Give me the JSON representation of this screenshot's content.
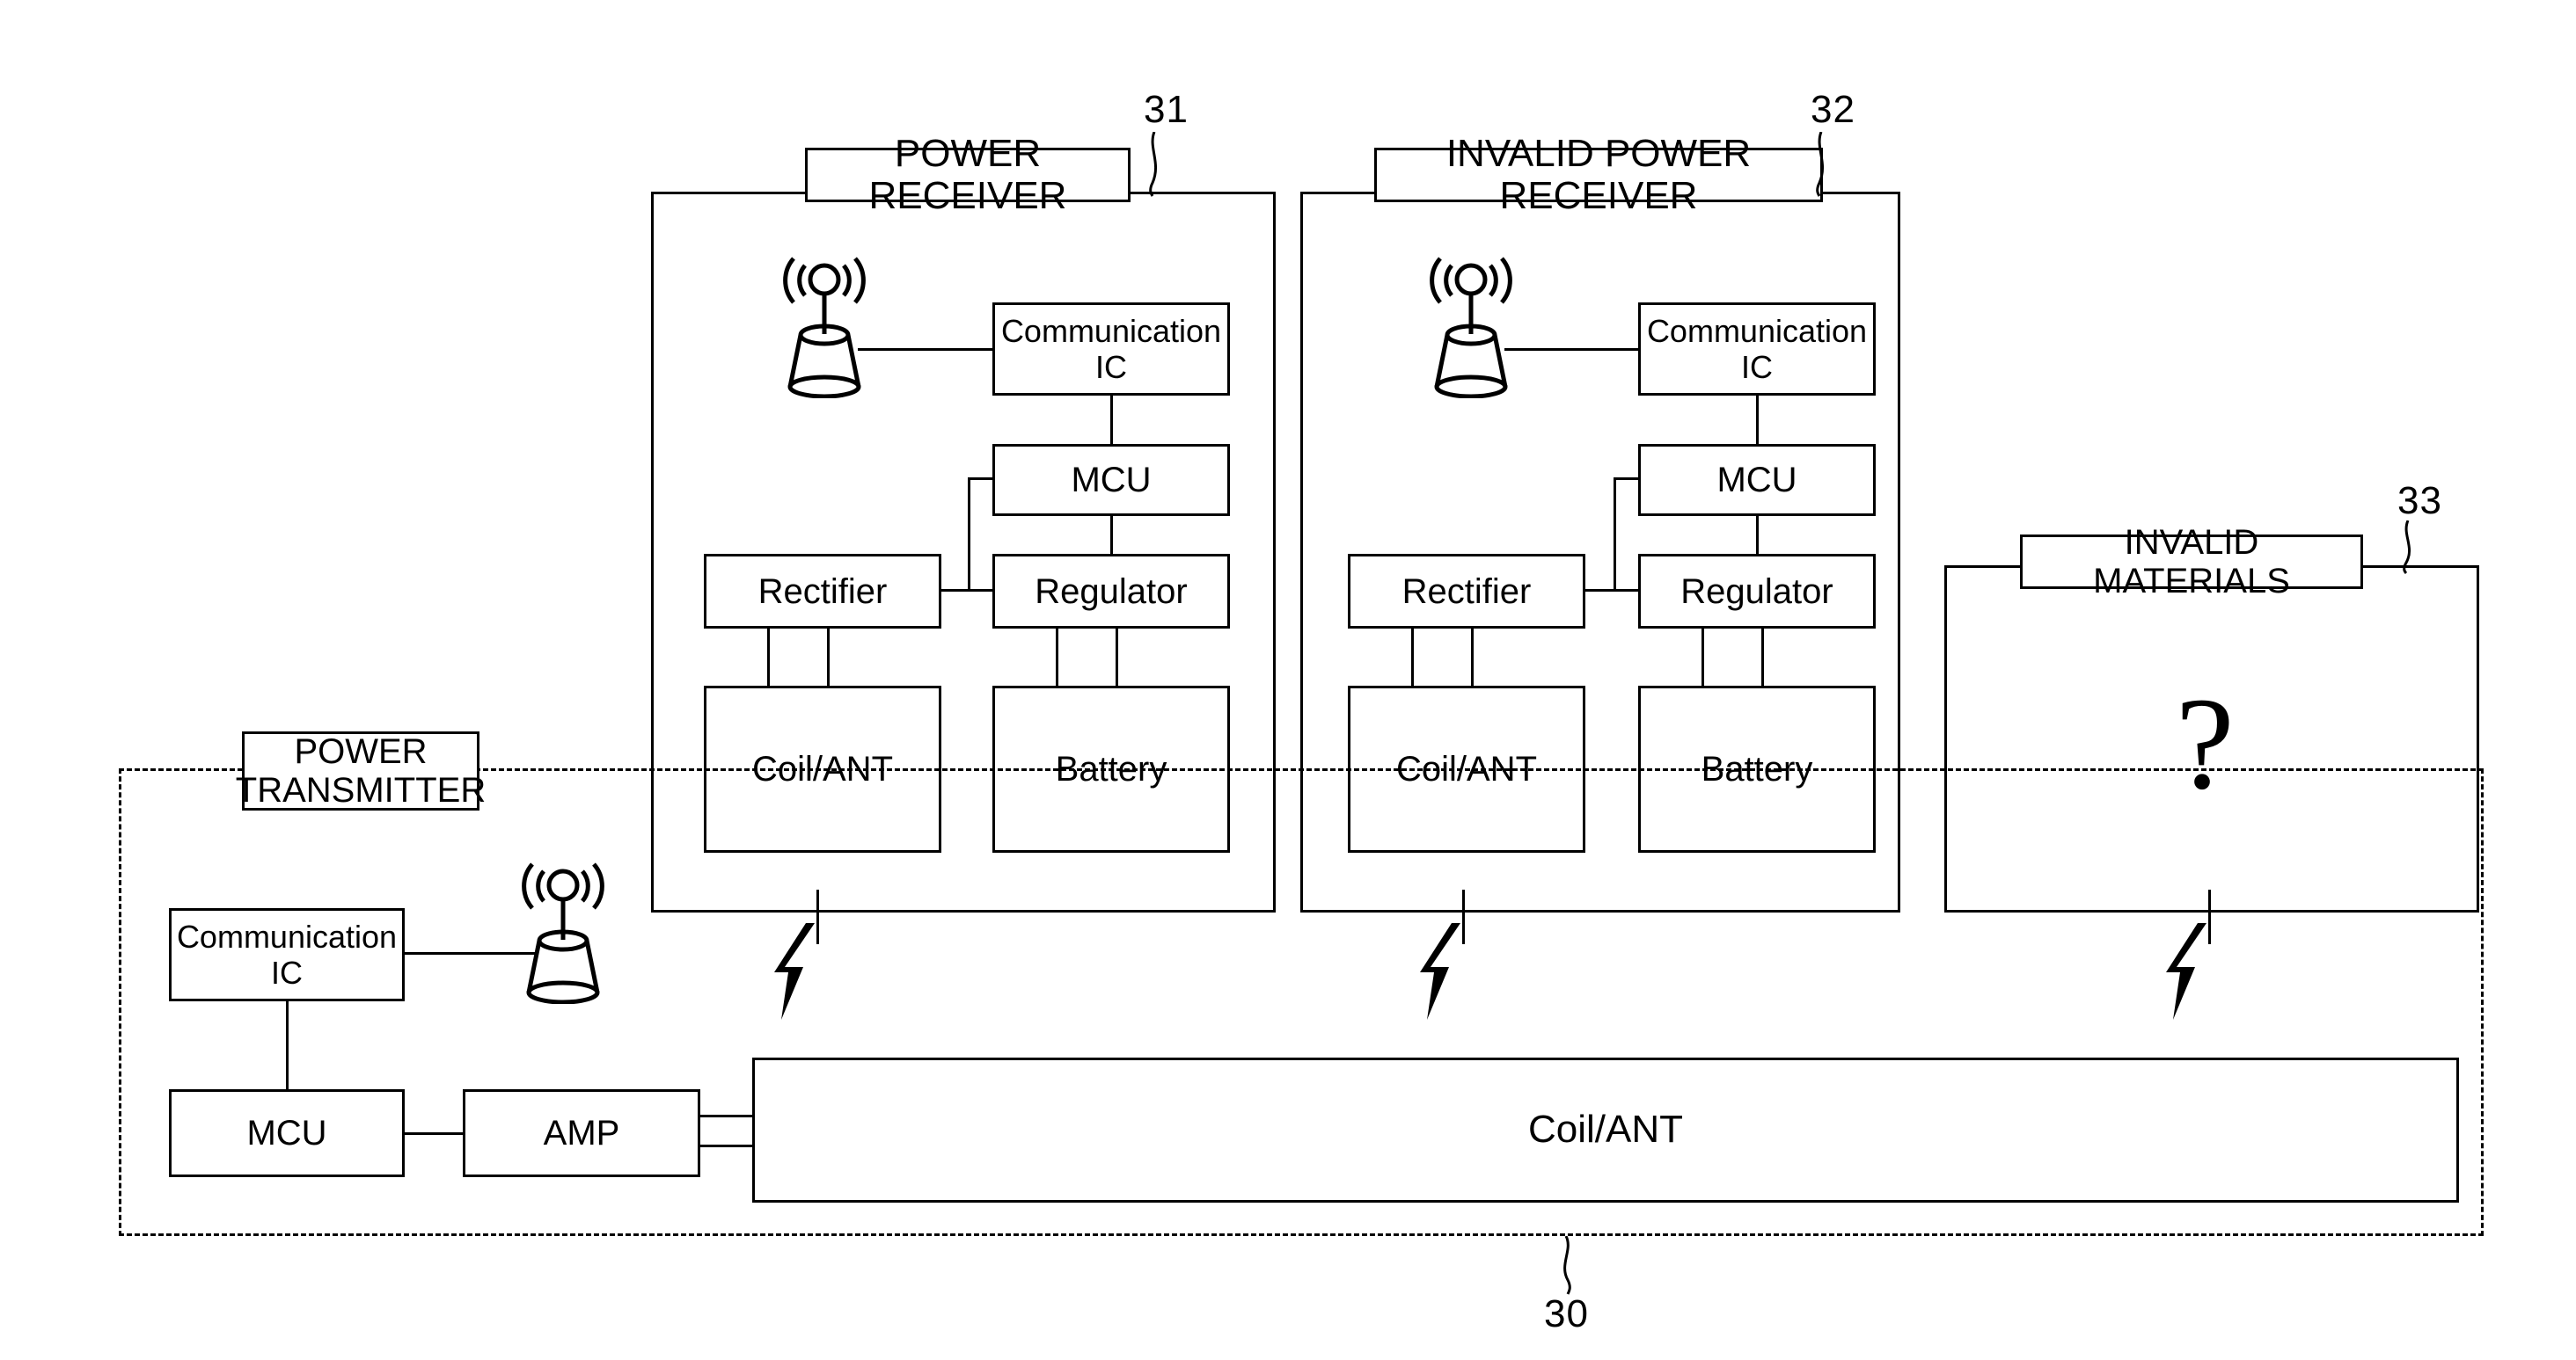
{
  "diagram": {
    "figure_type": "wireless-power-transfer-block-diagram",
    "reference_numerals": {
      "power_receiver": "31",
      "invalid_power_receiver": "32",
      "invalid_materials": "33",
      "power_transmitter_system": "30"
    },
    "power_receiver": {
      "title": "POWER RECEIVER",
      "blocks": {
        "communication_ic": "Communication\nIC",
        "communication_ic_line1": "Communication",
        "communication_ic_line2": "IC",
        "mcu": "MCU",
        "rectifier": "Rectifier",
        "regulator": "Regulator",
        "coil_ant": "Coil/ANT",
        "battery": "Battery"
      },
      "antenna_icon": "antenna-icon"
    },
    "invalid_power_receiver": {
      "title": "INVALID POWER RECEIVER",
      "blocks": {
        "communication_ic_line1": "Communication",
        "communication_ic_line2": "IC",
        "mcu": "MCU",
        "rectifier": "Rectifier",
        "regulator": "Regulator",
        "coil_ant": "Coil/ANT",
        "battery": "Battery"
      },
      "antenna_icon": "antenna-icon"
    },
    "invalid_materials": {
      "title": "INVALID MATERIALS",
      "content_symbol": "?"
    },
    "power_transmitter": {
      "title_line1": "POWER",
      "title_line2": "TRANSMITTER",
      "blocks": {
        "communication_ic_line1": "Communication",
        "communication_ic_line2": "IC",
        "mcu": "MCU",
        "amp": "AMP"
      },
      "antenna_icon": "antenna-icon"
    },
    "transmitter_coil": {
      "label": "Coil/ANT"
    },
    "coupling_symbols": {
      "icon": "lightning-bolt-icon",
      "count": 3
    },
    "colors": {
      "stroke": "#000000",
      "background": "#ffffff"
    }
  }
}
